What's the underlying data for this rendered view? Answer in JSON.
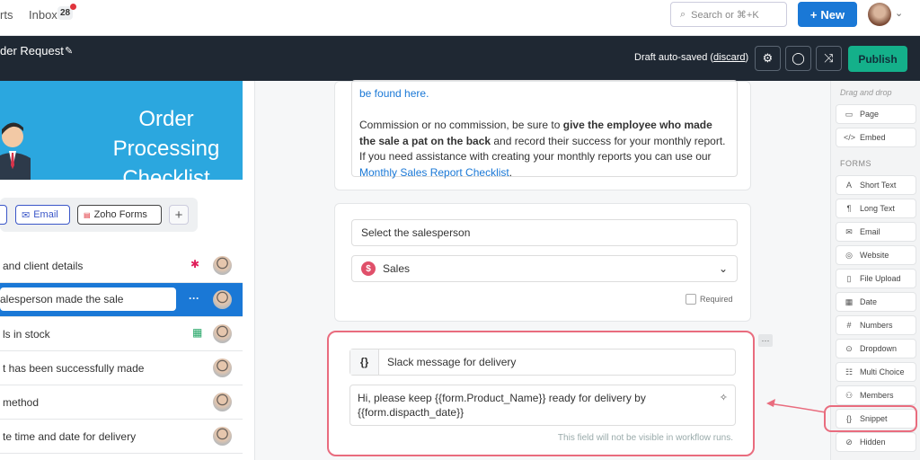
{
  "topbar": {
    "nav_partial": "rts",
    "inbox_label": "Inbox",
    "inbox_count": "28",
    "search_placeholder": "Search or ⌘+K",
    "new_label": "New"
  },
  "toolbar": {
    "title": "der Request",
    "draft_text": "Draft auto-saved (",
    "discard_label": "discard",
    "draft_close": ")",
    "publish_label": "Publish"
  },
  "left": {
    "banner_title": "Order Processing Checklist",
    "apps": [
      {
        "label": "Email",
        "icon": "envelope-icon",
        "color": "#3a56c8"
      },
      {
        "label": "Zoho Forms",
        "icon": "zoho-icon",
        "color": "#444444"
      }
    ],
    "tasks": [
      {
        "label": "and client details",
        "icon": "slack-icon"
      },
      {
        "label": "alesperson made the sale",
        "active": true
      },
      {
        "label": "ls in stock",
        "icon": "sheets-icon"
      },
      {
        "label": "t has been successfully made"
      },
      {
        "label": "method"
      },
      {
        "label": "te time and date for delivery"
      }
    ]
  },
  "content": {
    "link_top": "be found here.",
    "para_prefix": "Commission or no commission, be sure to ",
    "para_bold": "give the employee who made the sale a pat on the back",
    "para_mid": " and record their success for your monthly report. If you need assistance with creating your monthly reports you can use our ",
    "para_link": "Monthly Sales Report Checklist",
    "para_end": ".",
    "select_label": "Select the salesperson",
    "select_value": "Sales",
    "required_label": "Required",
    "snippet_label": "Slack message for delivery",
    "snippet_body": "Hi, please keep {{form.Product_Name}} ready for delivery by {{form.dispacth_date}}",
    "snippet_hint": "This field will not be visible in workflow runs."
  },
  "palette": {
    "drag_label": "Drag and drop",
    "forms_header": "FORMS",
    "top_items": [
      {
        "label": "Page",
        "icon": "page-icon"
      },
      {
        "label": "Embed",
        "icon": "embed-icon"
      }
    ],
    "form_items": [
      {
        "label": "Short Text",
        "icon": "short-text-icon"
      },
      {
        "label": "Long Text",
        "icon": "long-text-icon"
      },
      {
        "label": "Email",
        "icon": "email-icon"
      },
      {
        "label": "Website",
        "icon": "globe-icon"
      },
      {
        "label": "File Upload",
        "icon": "upload-icon"
      },
      {
        "label": "Date",
        "icon": "calendar-icon"
      },
      {
        "label": "Numbers",
        "icon": "numbers-icon"
      },
      {
        "label": "Dropdown",
        "icon": "dropdown-icon"
      },
      {
        "label": "Multi Choice",
        "icon": "multi-choice-icon"
      },
      {
        "label": "Members",
        "icon": "members-icon"
      },
      {
        "label": "Snippet",
        "icon": "braces-icon"
      },
      {
        "label": "Hidden",
        "icon": "hidden-icon"
      }
    ]
  },
  "colors": {
    "accent": "#1a78d6",
    "publish": "#14b08a",
    "highlight": "#e96c7e",
    "banner": "#2ba7df"
  }
}
